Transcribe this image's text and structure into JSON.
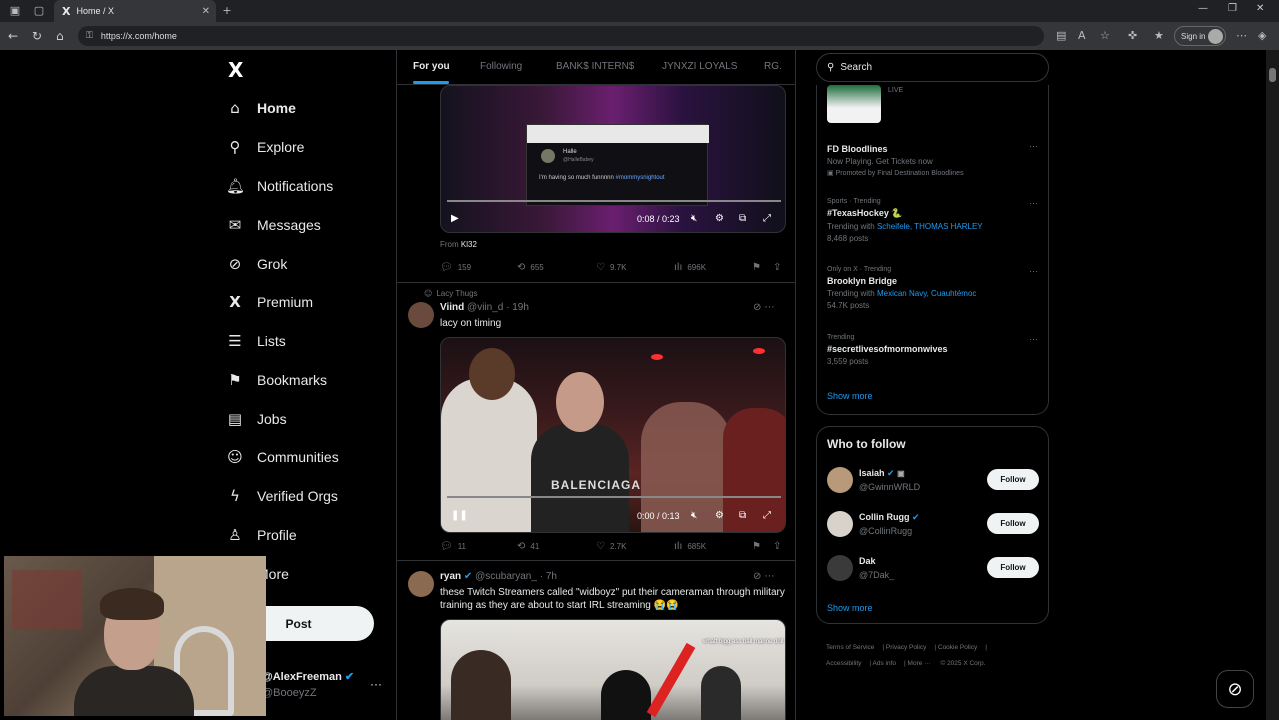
{
  "browser": {
    "tab_title": "Home / X",
    "tab_icon": "X",
    "url": "https://x.com/home",
    "signin_label": "Sign in"
  },
  "nav": {
    "logo": "X",
    "items": [
      {
        "label": "Home",
        "icon": "home-icon",
        "glyph": "⌂"
      },
      {
        "label": "Explore",
        "icon": "search-icon",
        "glyph": "⚲"
      },
      {
        "label": "Notifications",
        "icon": "bell-icon",
        "glyph": "♫"
      },
      {
        "label": "Messages",
        "icon": "envelope-icon",
        "glyph": "✉"
      },
      {
        "label": "Grok",
        "icon": "grok-icon",
        "glyph": "⊘"
      },
      {
        "label": "Premium",
        "icon": "x-premium-icon",
        "glyph": "X"
      },
      {
        "label": "Lists",
        "icon": "list-icon",
        "glyph": "☰"
      },
      {
        "label": "Bookmarks",
        "icon": "bookmark-icon",
        "glyph": "⚑"
      },
      {
        "label": "Jobs",
        "icon": "briefcase-icon",
        "glyph": "▤"
      },
      {
        "label": "Communities",
        "icon": "people-icon",
        "glyph": "☺"
      },
      {
        "label": "Verified Orgs",
        "icon": "lightning-icon",
        "glyph": "ϟ"
      },
      {
        "label": "Profile",
        "icon": "person-icon",
        "glyph": "♙"
      },
      {
        "label": "More",
        "icon": "more-icon",
        "glyph": "⋯"
      }
    ],
    "post_label": "Post",
    "profile_name": "@AlexFreeman",
    "profile_handle": "@BooeyzZ",
    "profile_more": "···"
  },
  "timeline": {
    "tabs": [
      "For you",
      "Following",
      "BANK$ INTERN$",
      "JYNXZI LOYALS",
      "RG."
    ],
    "post1": {
      "overlay_name": "Halle",
      "overlay_handle": "@HalleBabey",
      "overlay_text": "I'm having so much funnnnn",
      "overlay_hashtag": "#mommysnightout",
      "time": "0:08 / 0:23",
      "from_label": "From",
      "from_name": "Kl32",
      "replies": "159",
      "reposts": "655",
      "likes": "9.7K",
      "views": "696K"
    },
    "post2": {
      "social_context": "Lacy Thugs",
      "name": "Viind",
      "handle": "@viin_d · 19h",
      "text": "lacy on timing",
      "jersey_text": "BALENCIAGA",
      "time": "0:00 / 0:13",
      "replies": "11",
      "reposts": "41",
      "likes": "2.7K",
      "views": "685K"
    },
    "post3": {
      "name": "ryan",
      "handle": "@scubaryan_ · 7h",
      "text": "these Twitch Streamers called \"widboyz\" put their cameraman through military training as they are about to start IRL streaming 😭😭",
      "overlay_text": "whatt bigg ass ball marine drill"
    }
  },
  "sidebar": {
    "search_placeholder": "Search",
    "live_label": "LIVE",
    "trends": [
      {
        "meta": "",
        "title": "FD Bloodlines",
        "sub": "Now Playing. Get Tickets now",
        "sub2": "Promoted by Final Destination Bloodlines"
      },
      {
        "meta": "Sports · Trending",
        "title": "#TexasHockey 🐍",
        "sub_prefix": "Trending with",
        "sub_links": "Scheifele, THOMAS HARLEY",
        "count": "8,468 posts"
      },
      {
        "meta": "Only on X · Trending",
        "title": "Brooklyn Bridge",
        "sub_prefix": "Trending with",
        "sub_links": "Mexican Navy, Cuauhtémoc",
        "count": "54.7K posts"
      },
      {
        "meta": "Trending",
        "title": "#secretlivesofmormonwives",
        "count": "3,559 posts"
      }
    ],
    "show_more": "Show more",
    "who_to_follow": {
      "title": "Who to follow",
      "accounts": [
        {
          "name": "Isaiah",
          "handle": "@GwinnWRLD",
          "button": "Follow"
        },
        {
          "name": "Collin Rugg",
          "handle": "@CollinRugg",
          "button": "Follow"
        },
        {
          "name": "Dak",
          "handle": "@7Dak_",
          "button": "Follow"
        }
      ],
      "show_more": "Show more"
    },
    "footer": [
      "Terms of Service",
      "Privacy Policy",
      "Cookie Policy",
      "Accessibility",
      "Ads info",
      "More ···",
      "© 2025 X Corp."
    ]
  }
}
